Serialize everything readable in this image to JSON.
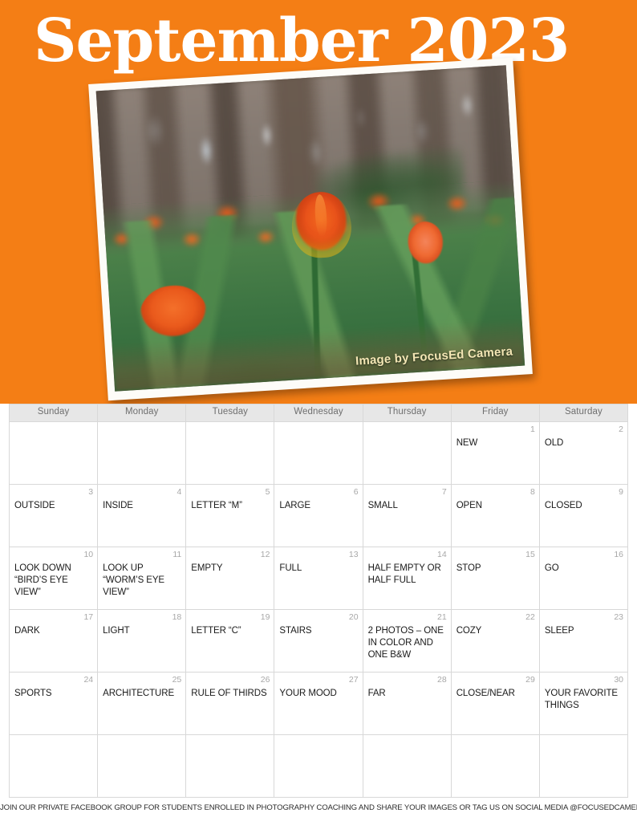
{
  "colors": {
    "brand_orange": "#F47E15",
    "header_gray": "#E7E7E7",
    "grid_line": "#D8D8D8",
    "daynum_gray": "#A8A8A8",
    "watermark_cream": "#F3E6B4"
  },
  "header": {
    "title": "September 2023"
  },
  "photo": {
    "watermark": "Image by FocusEd Camera",
    "alt": "Field of orange tulips with blurred woodland background"
  },
  "calendar": {
    "weekday_headers": [
      "Sunday",
      "Monday",
      "Tuesday",
      "Wednesday",
      "Thursday",
      "Friday",
      "Saturday"
    ],
    "weeks": [
      [
        {
          "day": "",
          "event": ""
        },
        {
          "day": "",
          "event": ""
        },
        {
          "day": "",
          "event": ""
        },
        {
          "day": "",
          "event": ""
        },
        {
          "day": "",
          "event": ""
        },
        {
          "day": "1",
          "event": "NEW"
        },
        {
          "day": "2",
          "event": "OLD"
        }
      ],
      [
        {
          "day": "3",
          "event": "OUTSIDE"
        },
        {
          "day": "4",
          "event": "INSIDE"
        },
        {
          "day": "5",
          "event": "LETTER “M”"
        },
        {
          "day": "6",
          "event": "LARGE"
        },
        {
          "day": "7",
          "event": "SMALL"
        },
        {
          "day": "8",
          "event": "OPEN"
        },
        {
          "day": "9",
          "event": "CLOSED"
        }
      ],
      [
        {
          "day": "10",
          "event": "LOOK DOWN “BIRD’S EYE VIEW”"
        },
        {
          "day": "11",
          "event": "LOOK UP “WORM’S EYE VIEW”"
        },
        {
          "day": "12",
          "event": "EMPTY"
        },
        {
          "day": "13",
          "event": "FULL"
        },
        {
          "day": "14",
          "event": "HALF EMPTY OR HALF FULL"
        },
        {
          "day": "15",
          "event": "STOP"
        },
        {
          "day": "16",
          "event": "GO"
        }
      ],
      [
        {
          "day": "17",
          "event": "DARK"
        },
        {
          "day": "18",
          "event": "LIGHT"
        },
        {
          "day": "19",
          "event": "LETTER “C”"
        },
        {
          "day": "20",
          "event": "STAIRS"
        },
        {
          "day": "21",
          "event": "2 PHOTOS – ONE IN COLOR AND ONE B&W"
        },
        {
          "day": "22",
          "event": "COZY"
        },
        {
          "day": "23",
          "event": "SLEEP"
        }
      ],
      [
        {
          "day": "24",
          "event": "SPORTS"
        },
        {
          "day": "25",
          "event": "ARCHITECTURE"
        },
        {
          "day": "26",
          "event": "RULE OF THIRDS"
        },
        {
          "day": "27",
          "event": "YOUR MOOD"
        },
        {
          "day": "28",
          "event": "FAR"
        },
        {
          "day": "29",
          "event": "CLOSE/NEAR"
        },
        {
          "day": "30",
          "event": "YOUR FAVORITE THINGS"
        }
      ],
      [
        {
          "day": "",
          "event": ""
        },
        {
          "day": "",
          "event": ""
        },
        {
          "day": "",
          "event": ""
        },
        {
          "day": "",
          "event": ""
        },
        {
          "day": "",
          "event": ""
        },
        {
          "day": "",
          "event": ""
        },
        {
          "day": "",
          "event": ""
        }
      ]
    ]
  },
  "footer": {
    "text": "JOIN OUR PRIVATE FACEBOOK GROUP FOR STUDENTS ENROLLED IN PHOTOGRAPHY COACHING AND SHARE YOUR IMAGES OR TAG US ON SOCIAL MEDIA @FOCUSEDCAMERA"
  }
}
